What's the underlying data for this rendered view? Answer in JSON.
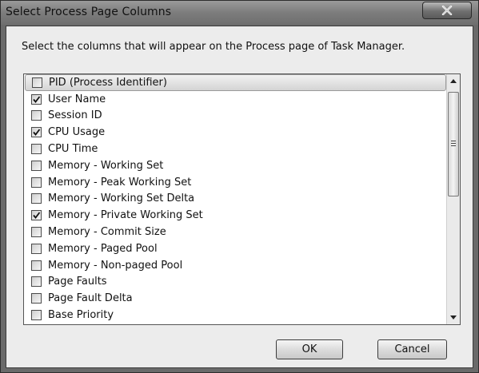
{
  "window": {
    "title": "Select Process Page Columns",
    "close_symbol": "x"
  },
  "instruction": "Select the columns that will appear on the Process page of Task Manager.",
  "columns": [
    {
      "label": "PID (Process Identifier)",
      "checked": false,
      "highlighted": true
    },
    {
      "label": "User Name",
      "checked": true
    },
    {
      "label": "Session ID",
      "checked": false
    },
    {
      "label": "CPU Usage",
      "checked": true
    },
    {
      "label": "CPU Time",
      "checked": false
    },
    {
      "label": "Memory - Working Set",
      "checked": false
    },
    {
      "label": "Memory - Peak Working Set",
      "checked": false
    },
    {
      "label": "Memory - Working Set Delta",
      "checked": false
    },
    {
      "label": "Memory - Private Working Set",
      "checked": true
    },
    {
      "label": "Memory - Commit Size",
      "checked": false
    },
    {
      "label": "Memory - Paged Pool",
      "checked": false
    },
    {
      "label": "Memory - Non-paged Pool",
      "checked": false
    },
    {
      "label": "Page Faults",
      "checked": false
    },
    {
      "label": "Page Fault Delta",
      "checked": false
    },
    {
      "label": "Base Priority",
      "checked": false
    }
  ],
  "buttons": {
    "ok_label": "OK",
    "cancel_label": "Cancel"
  },
  "icons": {
    "close": "close-icon",
    "scroll_up": "chevron-up-icon",
    "scroll_down": "chevron-down-icon",
    "checkmark": "checkmark-icon"
  }
}
